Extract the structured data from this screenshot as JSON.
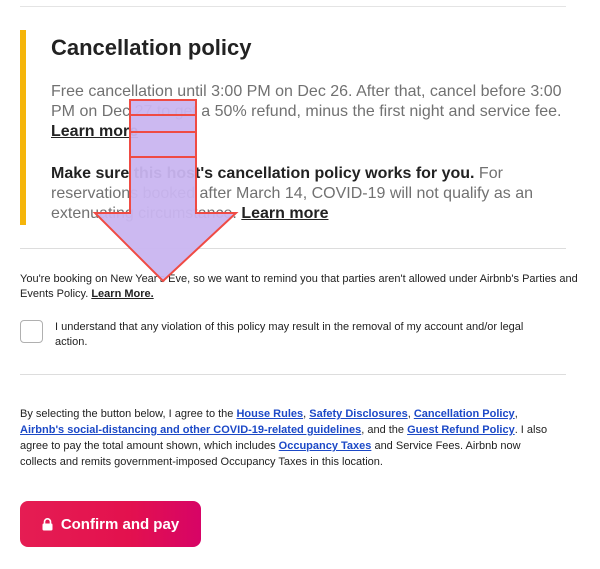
{
  "policy": {
    "title": "Cancellation policy",
    "free_cancel_text": "Free cancellation until 3:00 PM on Dec 26. After that, cancel before 3:00 PM on Dec 27 to get a 50% refund, minus the first night and service fee. ",
    "learn_more_1": "Learn more",
    "make_sure_bold": "Make sure this host's cancellation policy works for you.",
    "covid_text": " For reservations booked after March 14, COVID-19 will not qualify as an extenuating circumstance. ",
    "learn_more_2": "Learn more"
  },
  "notice": {
    "text": "You're booking on New Year's Eve, so we want to remind you that parties aren't allowed under Airbnb's Parties and Events Policy. ",
    "learn_more": "Learn More."
  },
  "acknowledgement": {
    "text": "I understand that any violation of this policy may result in the removal of my account and/or legal action."
  },
  "agreement": {
    "intro": "By selecting the button below, I agree to the ",
    "house_rules": "House Rules",
    "sep1": ", ",
    "safety": "Safety Disclosures",
    "sep2": ", ",
    "cancellation": "Cancellation Policy",
    "sep3": ", ",
    "covid_guidelines": "Airbnb's social-distancing and other COVID-19-related guidelines",
    "sep4": ", and the ",
    "refund": "Guest Refund Policy",
    "mid": ". I also agree to pay the total amount shown, which includes ",
    "occupancy": "Occupancy Taxes",
    "outro": " and Service Fees. Airbnb now collects and remits government-imposed Occupancy Taxes in this location."
  },
  "confirm": {
    "label": "Confirm and pay",
    "icon": "lock-icon"
  },
  "colors": {
    "accent": "#f5b50a",
    "link": "#1c49c7",
    "button": "#e51d53",
    "overlay_fill": "#c9b5f0",
    "overlay_stroke": "#ef4b44"
  }
}
